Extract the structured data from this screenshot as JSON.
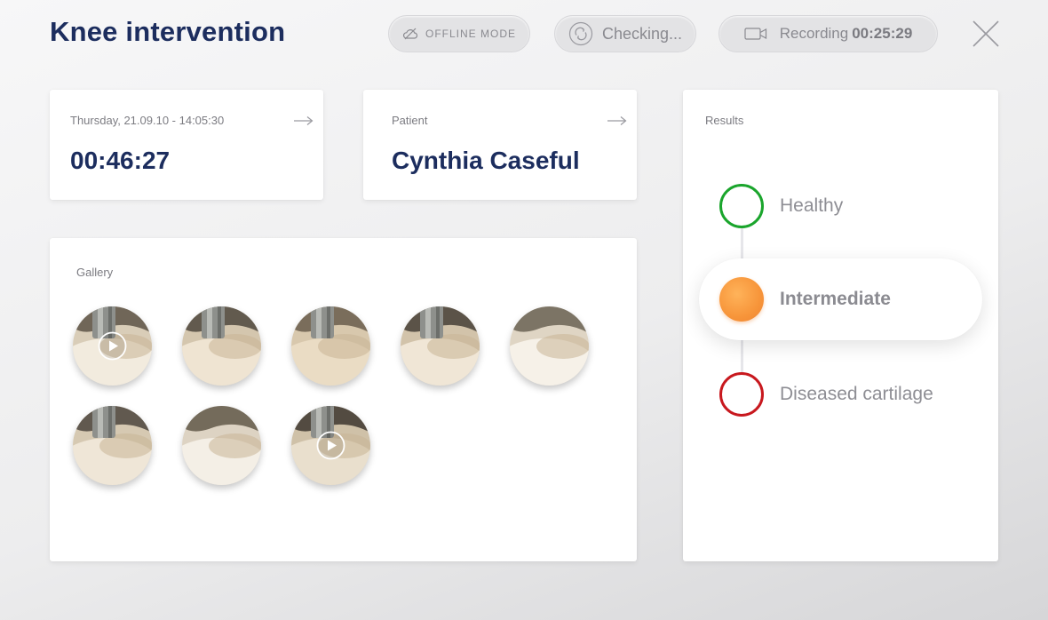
{
  "header": {
    "title": "Knee intervention",
    "offline_label": "OFFLINE MODE",
    "checking_label": "Checking...",
    "recording_label": "Recording",
    "recording_time": "00:25:29"
  },
  "session": {
    "datetime": "Thursday, 21.09.10  -  14:05:30",
    "elapsed": "00:46:27"
  },
  "patient": {
    "label": "Patient",
    "name": "Cynthia Caseful"
  },
  "gallery": {
    "label": "Gallery",
    "items": [
      {
        "type": "video"
      },
      {
        "type": "image"
      },
      {
        "type": "image"
      },
      {
        "type": "image"
      },
      {
        "type": "image"
      },
      {
        "type": "image"
      },
      {
        "type": "image"
      },
      {
        "type": "video"
      }
    ]
  },
  "results": {
    "label": "Results",
    "options": [
      {
        "label": "Healthy",
        "color": "#1aa52c",
        "selected": false
      },
      {
        "label": "Intermediate",
        "color": "#f7953a",
        "selected": true
      },
      {
        "label": "Diseased cartilage",
        "color": "#c8181e",
        "selected": false
      }
    ]
  },
  "icons": {
    "offline": "cloud-off-icon",
    "checking": "sync-icon",
    "recording": "camera-icon",
    "close": "close-icon",
    "arrow": "arrow-right-icon",
    "play": "play-icon"
  }
}
